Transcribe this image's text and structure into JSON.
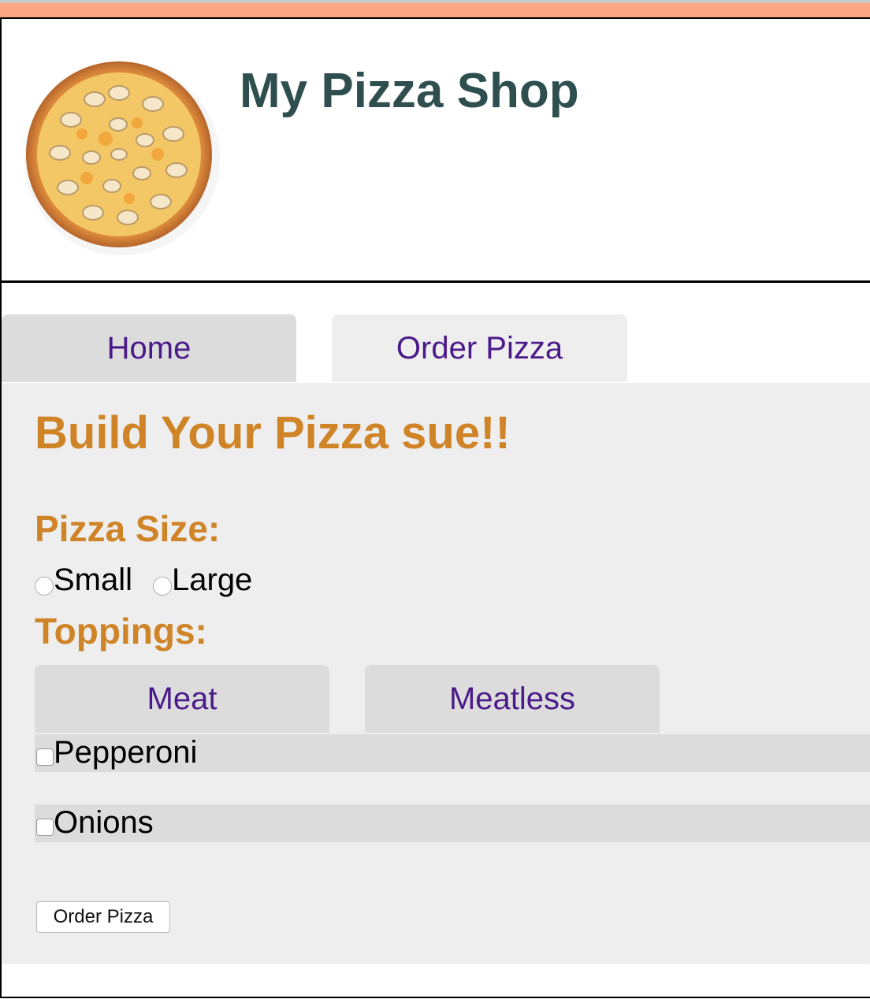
{
  "colors": {
    "top_bar": "#fba784",
    "title": "#2f4f4f",
    "heading": "#d08428",
    "tab_text": "#4b1a8a",
    "tab_bg": "#dcdcdc",
    "panel_bg": "#eeeeee"
  },
  "header": {
    "logo_icon": "pizza-image",
    "title": "My Pizza Shop"
  },
  "nav": {
    "tabs": [
      {
        "label": "Home",
        "active": false
      },
      {
        "label": "Order Pizza",
        "active": true
      }
    ]
  },
  "order": {
    "title": "Build Your Pizza sue!!",
    "size": {
      "heading": "Pizza Size:",
      "options": [
        {
          "label": "Small",
          "checked": false
        },
        {
          "label": "Large",
          "checked": false
        }
      ]
    },
    "toppings": {
      "heading": "Toppings:",
      "tabs": [
        {
          "label": "Meat"
        },
        {
          "label": "Meatless"
        }
      ],
      "items": [
        {
          "label": "Pepperoni",
          "checked": false
        },
        {
          "label": "Onions",
          "checked": false
        }
      ]
    },
    "submit_label": "Order Pizza"
  }
}
